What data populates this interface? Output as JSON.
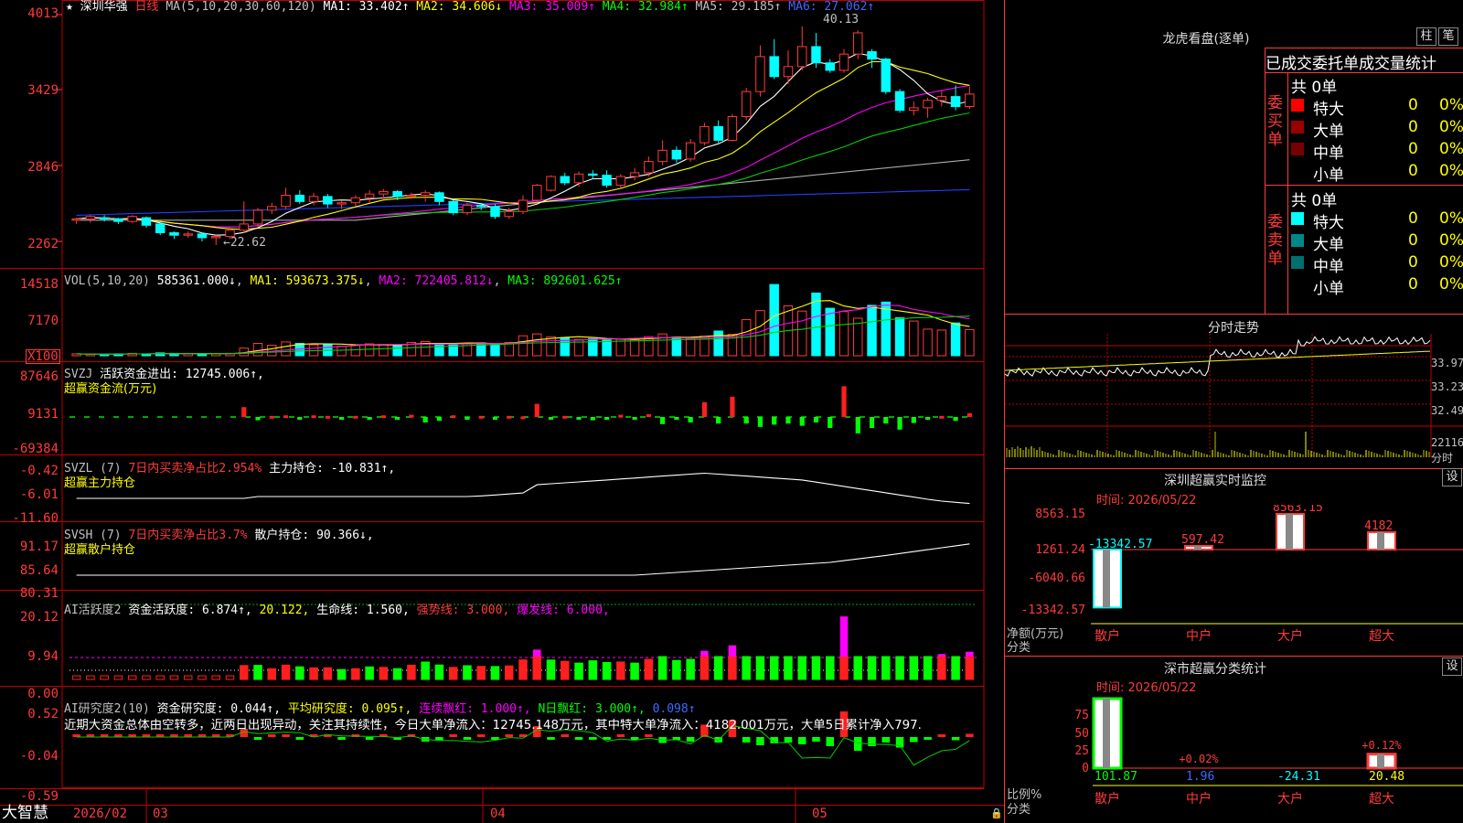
{
  "header": {
    "symbol_star": "★",
    "stock_name": "深圳华强",
    "period": "日线",
    "ma_label": "MA(5,10,20,30,60,120)",
    "ma1": "MA1: 33.402↑",
    "ma2": "MA2: 34.606↓",
    "ma3": "MA3: 35.009↑",
    "ma4": "MA4: 32.984↑",
    "ma5": "MA5: 29.185↑",
    "ma6": "MA6: 27.062↑"
  },
  "price_axis": [
    "4013",
    "3429",
    "2846",
    "2262"
  ],
  "price_annotations": {
    "high": "40.13",
    "low": "←22.62"
  },
  "vol": {
    "label": "VOL(5,10,20)",
    "value": "585361.000↓",
    "ma1": "MA1: 593673.375↓",
    "ma2": "MA2: 722405.812↓",
    "ma3": "MA3: 892601.625↑",
    "axis": [
      "14518",
      "7170",
      "X100"
    ]
  },
  "svzj": {
    "line1a": "SVZJ",
    "line1b": "活跃资金进出: 12745.006↑,",
    "line2": "超赢资金流(万元)",
    "axis": [
      "87646",
      "9131",
      "-69384"
    ]
  },
  "svzl": {
    "a": "SVZL (7)",
    "b": "7日内买卖净占比2.954%",
    "c": "主力持仓: -10.831↑,",
    "line2": "超赢主力持仓",
    "axis": [
      "-0.42",
      "-6.01",
      "-11.60"
    ]
  },
  "svsh": {
    "a": "SVSH (7)",
    "b": "7日内买卖净占比3.7%",
    "c": "散户持仓: 90.366↓,",
    "line2": "超赢散户持仓",
    "axis": [
      "91.17",
      "85.64",
      "80.31"
    ]
  },
  "ai_active": {
    "a": "AI活跃度2",
    "b": "资金活跃度: 6.874↑,",
    "c": "20.122,",
    "d": "生命线: 1.560,",
    "e": "强势线: 3.000,",
    "f": "爆发线: 6.000,",
    "axis": [
      "20.12",
      "9.94",
      "0.00"
    ]
  },
  "ai_research": {
    "a": "AI研究度2(10)",
    "b": "资金研究度: 0.044↑,",
    "c": "平均研究度: 0.095↑,",
    "d": "连续飘红: 1.000↑,",
    "e": "N日飘红: 3.000↑,",
    "f": "0.098↑",
    "commentary": "近期大资金总体由空转多，近两日出现异动，关注其持续性，今日大单净流入：12745.148万元，其中特大单净流入：4182.001万元，大单5日累计净入797.",
    "axis": [
      "0.52",
      "-0.04",
      "-0.59"
    ]
  },
  "date_axis": {
    "brand": "大智慧",
    "labels": [
      "2026/02",
      "03",
      "04",
      "05"
    ]
  },
  "dragon_tiger": {
    "title": "龙虎看盘(逐单)",
    "btn_bar": "柱",
    "btn_pen": "笔",
    "header": "已成交委托单成交量统计",
    "buy_label": "委买单",
    "sell_label": "委卖单",
    "buy_total": "共 0单",
    "sell_total": "共 0单",
    "buy_rows": [
      {
        "name": "特大",
        "count": "0",
        "pct": "0%",
        "color": "#ff0000"
      },
      {
        "name": "大单",
        "count": "0",
        "pct": "0%",
        "color": "#990000"
      },
      {
        "name": "中单",
        "count": "0",
        "pct": "0%",
        "color": "#770000"
      },
      {
        "name": "小单",
        "count": "0",
        "pct": "0%",
        "color": "#000000"
      }
    ],
    "sell_rows": [
      {
        "name": "特大",
        "count": "0",
        "pct": "0%",
        "color": "#00ffff"
      },
      {
        "name": "大单",
        "count": "0",
        "pct": "0%",
        "color": "#008888"
      },
      {
        "name": "中单",
        "count": "0",
        "pct": "0%",
        "color": "#006f6f"
      },
      {
        "name": "小单",
        "count": "0",
        "pct": "0%",
        "color": "#000000"
      }
    ]
  },
  "intraday": {
    "title": "分时走势",
    "prices": [
      "33.97",
      "33.23",
      "32.49"
    ],
    "vol_label": "22116",
    "vol_unit": "分时"
  },
  "monitor": {
    "title": "深圳超赢实时监控",
    "btn": "设",
    "time": "时间: 2026/05/22",
    "axis": [
      "8563.15",
      "1261.24",
      "-6040.66",
      "-13342.57"
    ],
    "side_label": [
      "净额(万元)",
      "分类"
    ],
    "categories": [
      "散户",
      "中户",
      "大户",
      "超大"
    ],
    "values": [
      -13342.57,
      597.42,
      8563.15,
      4182
    ],
    "value_labels": [
      "-13342.57",
      "597.42",
      "8563.15",
      "4182"
    ]
  },
  "classify": {
    "title": "深市超赢分类统计",
    "btn": "设",
    "time": "时间: 2026/05/22",
    "axis": [
      "75",
      "50",
      "25",
      "0"
    ],
    "side_label": [
      "比例%",
      "分类"
    ],
    "categories": [
      "散户",
      "中户",
      "大户",
      "超大"
    ],
    "bar_labels": [
      "",
      "+0.02%",
      "",
      "+0.12%"
    ],
    "bottom_values": [
      "101.87",
      "1.96",
      "-24.31",
      "20.48"
    ],
    "bar_heights": [
      101.87,
      0,
      0,
      20.48
    ]
  },
  "chart_data": {
    "type": "candlestick",
    "ylim": [
      21,
      41.5
    ],
    "candles": [
      [
        24.6,
        24.7,
        24.3,
        24.8
      ],
      [
        24.7,
        24.9,
        24.4,
        25.0
      ],
      [
        24.8,
        24.7,
        24.5,
        25.0
      ],
      [
        24.7,
        24.5,
        24.3,
        24.8
      ],
      [
        24.5,
        24.9,
        24.4,
        25.0
      ],
      [
        24.8,
        24.2,
        24.0,
        24.9
      ],
      [
        24.3,
        23.6,
        23.4,
        24.4
      ],
      [
        23.6,
        23.4,
        23.1,
        23.7
      ],
      [
        23.4,
        23.5,
        23.2,
        23.7
      ],
      [
        23.5,
        23.2,
        22.9,
        23.6
      ],
      [
        23.2,
        23.3,
        22.6,
        23.5
      ],
      [
        23.3,
        23.8,
        23.1,
        24.0
      ],
      [
        23.8,
        24.3,
        23.6,
        26.1
      ],
      [
        24.3,
        25.4,
        24.1,
        25.6
      ],
      [
        25.4,
        25.7,
        25.1,
        26.0
      ],
      [
        25.7,
        26.6,
        25.5,
        27.2
      ],
      [
        26.6,
        26.1,
        25.9,
        27.0
      ],
      [
        26.1,
        26.5,
        25.8,
        26.8
      ],
      [
        26.5,
        25.9,
        25.6,
        26.7
      ],
      [
        25.9,
        26.0,
        25.5,
        26.2
      ],
      [
        26.0,
        26.4,
        25.7,
        26.6
      ],
      [
        26.4,
        26.7,
        26.0,
        27.0
      ],
      [
        26.7,
        26.9,
        26.3,
        27.1
      ],
      [
        26.9,
        26.5,
        26.2,
        27.0
      ],
      [
        26.5,
        26.6,
        26.3,
        26.8
      ],
      [
        26.6,
        26.8,
        26.1,
        27.0
      ],
      [
        26.8,
        26.1,
        25.8,
        26.9
      ],
      [
        26.1,
        25.2,
        25.0,
        26.2
      ],
      [
        25.2,
        25.8,
        25.0,
        26.0
      ],
      [
        25.8,
        25.7,
        25.4,
        26.0
      ],
      [
        25.7,
        24.9,
        24.7,
        25.9
      ],
      [
        24.9,
        25.3,
        24.7,
        25.6
      ],
      [
        25.3,
        26.2,
        25.1,
        26.6
      ],
      [
        26.2,
        27.4,
        26.0,
        27.5
      ],
      [
        27.0,
        28.1,
        26.9,
        28.2
      ],
      [
        28.1,
        27.6,
        27.4,
        28.4
      ],
      [
        27.6,
        28.3,
        27.3,
        28.5
      ],
      [
        28.3,
        28.2,
        27.9,
        28.6
      ],
      [
        28.2,
        27.4,
        27.2,
        28.6
      ],
      [
        27.4,
        28.1,
        27.2,
        28.3
      ],
      [
        28.1,
        28.4,
        27.8,
        28.8
      ],
      [
        28.4,
        29.3,
        28.1,
        29.7
      ],
      [
        29.3,
        30.2,
        29.0,
        31.0
      ],
      [
        30.2,
        29.5,
        29.2,
        30.5
      ],
      [
        29.5,
        30.8,
        29.3,
        31.1
      ],
      [
        30.8,
        32.1,
        30.6,
        32.4
      ],
      [
        32.1,
        31.0,
        30.8,
        32.6
      ],
      [
        31.0,
        32.9,
        30.9,
        33.1
      ],
      [
        32.9,
        34.9,
        32.6,
        35.2
      ],
      [
        34.9,
        37.7,
        34.5,
        38.6
      ],
      [
        37.7,
        36.1,
        35.9,
        39.1
      ],
      [
        36.1,
        36.9,
        35.5,
        38.2
      ],
      [
        36.9,
        38.5,
        36.6,
        40.13
      ],
      [
        38.5,
        37.2,
        36.8,
        39.6
      ],
      [
        37.2,
        36.6,
        36.4,
        37.5
      ],
      [
        36.6,
        37.9,
        36.4,
        38.3
      ],
      [
        37.9,
        39.6,
        37.5,
        39.8
      ],
      [
        38.1,
        37.5,
        36.8,
        38.3
      ],
      [
        37.5,
        34.9,
        34.7,
        37.6
      ],
      [
        34.9,
        33.4,
        33.2,
        35.1
      ],
      [
        33.4,
        33.6,
        33.0,
        34.1
      ],
      [
        33.6,
        34.2,
        32.8,
        34.4
      ],
      [
        34.2,
        34.5,
        33.7,
        35.0
      ],
      [
        34.5,
        33.7,
        33.4,
        35.4
      ],
      [
        33.7,
        34.7,
        33.5,
        35.3
      ]
    ],
    "volume": [
      0.4,
      0.3,
      0.3,
      0.4,
      0.5,
      0.4,
      0.6,
      0.5,
      0.4,
      0.3,
      0.4,
      0.5,
      1.6,
      2.6,
      2.2,
      2.9,
      2.6,
      2.3,
      2.4,
      2.0,
      2.2,
      2.5,
      2.4,
      2.2,
      2.8,
      3.0,
      2.6,
      2.4,
      2.6,
      2.7,
      2.5,
      2.8,
      4.2,
      4.6,
      4.0,
      3.8,
      3.4,
      3.6,
      3.3,
      3.5,
      3.4,
      4.0,
      4.6,
      3.9,
      3.6,
      4.1,
      5.2,
      4.5,
      7.6,
      9.5,
      15.0,
      10.5,
      9.4,
      13.2,
      10.0,
      9.3,
      7.9,
      10.6,
      11.3,
      8.0,
      7.3,
      5.6,
      5.4,
      6.9,
      5.5
    ],
    "flow": [
      0,
      0,
      0,
      0,
      0,
      0,
      0,
      0,
      0,
      0,
      0,
      0,
      18,
      -6,
      2,
      3,
      -2,
      3,
      2,
      -2,
      2,
      -3,
      3,
      -2,
      4,
      -10,
      -7,
      3,
      -5,
      2,
      -4,
      2,
      1,
      24,
      -3,
      2,
      -2,
      -6,
      -5,
      4,
      -2,
      5,
      -13,
      -3,
      -10,
      27,
      -12,
      37,
      -12,
      -18,
      -14,
      -12,
      -16,
      -10,
      -20,
      56,
      -30,
      -20,
      -12,
      -23,
      -11,
      -3,
      2,
      -7,
      7
    ]
  }
}
